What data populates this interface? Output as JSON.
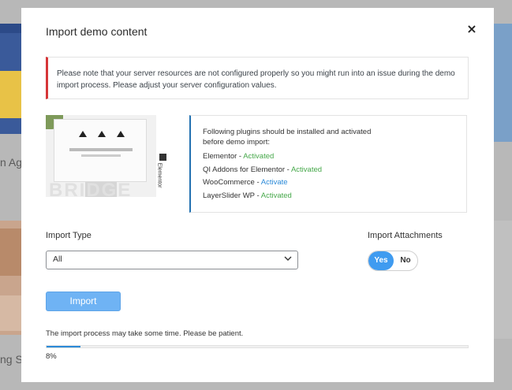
{
  "background": {
    "left_text_1": "n Ag",
    "left_text_2": "ng S"
  },
  "modal": {
    "title": "Import demo content",
    "close_label": "×",
    "notice": "Please note that your server resources are not configured properly so you might run into an issue during the demo import process. Please adjust your server configuration values.",
    "preview": {
      "brand_text": "BRIDGE",
      "elementor_badge": "Elementor"
    },
    "plugins": {
      "intro": "Following plugins should be installed and activated before demo import:",
      "items": [
        {
          "name": "Elementor - ",
          "status": "Activated",
          "state": "activated"
        },
        {
          "name": "QI Addons for Elementor - ",
          "status": "Activated",
          "state": "activated"
        },
        {
          "name": "WooCommerce - ",
          "status": "Activate",
          "state": "activate"
        },
        {
          "name": "LayerSlider WP - ",
          "status": "Activated",
          "state": "activated"
        }
      ]
    },
    "import_type": {
      "label": "Import Type",
      "selected": "All"
    },
    "import_attachments": {
      "label": "Import Attachments",
      "yes": "Yes",
      "no": "No",
      "value": "Yes"
    },
    "import_button": "Import",
    "process_note": "The import process may take some time. Please be patient.",
    "progress": {
      "percent_value": 8,
      "percent_label": "8%"
    }
  },
  "colors": {
    "notice_border": "#d63638",
    "plugins_border": "#2271b1",
    "activated": "#46a84a",
    "activate": "#2b8ad8",
    "toggle_on": "#3f9bf0",
    "import_button": "#6fb3f4",
    "progress_fill": "#2b8ad8"
  }
}
